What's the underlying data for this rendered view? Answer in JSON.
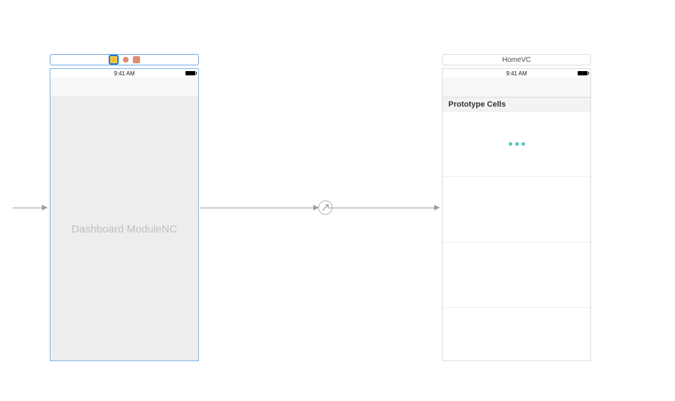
{
  "entry_arrow": {
    "present": true
  },
  "segue": {
    "type": "relationship"
  },
  "left_scene": {
    "selected": true,
    "statusbar_time": "9:41 AM",
    "placeholder_label": "Dashboard ModuleNC"
  },
  "right_scene": {
    "title": "HomeVC",
    "statusbar_time": "9:41 AM",
    "section_header": "Prototype Cells",
    "cells": [
      {
        "kind": "loading-dots"
      },
      {
        "kind": "empty"
      },
      {
        "kind": "empty"
      }
    ]
  }
}
